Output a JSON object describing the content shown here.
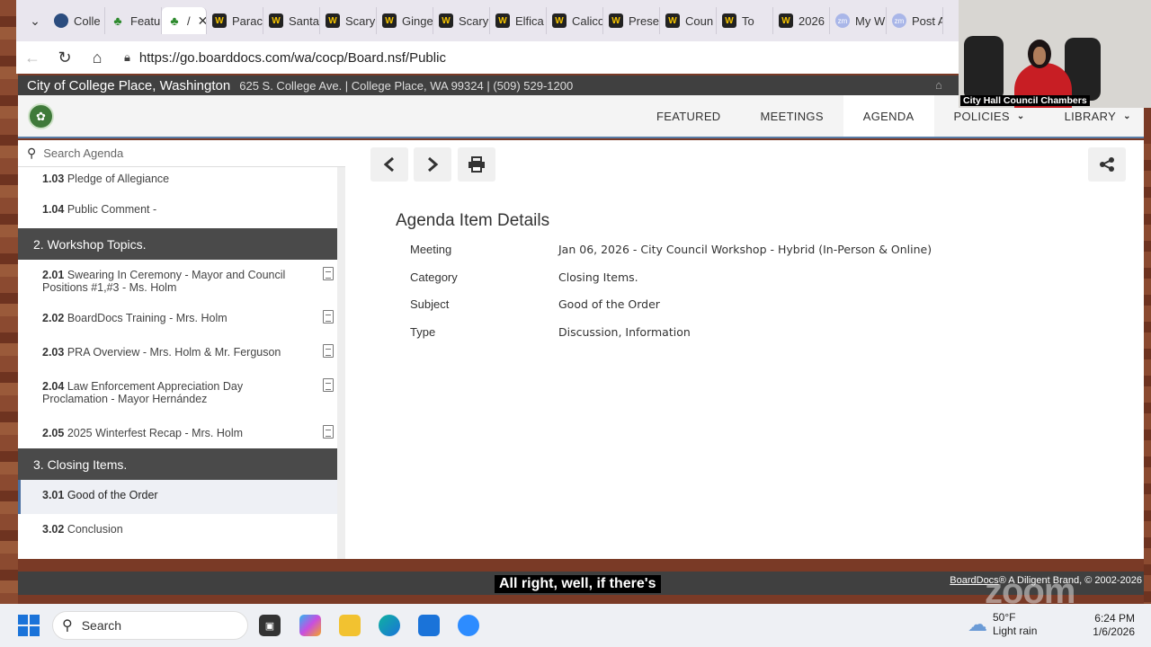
{
  "browser": {
    "tabs": [
      {
        "icon": "globe",
        "label": "Colle"
      },
      {
        "icon": "tree",
        "label": "Featu"
      },
      {
        "icon": "tree",
        "label": "/",
        "active": true
      },
      {
        "icon": "boarddocs",
        "label": "Parac"
      },
      {
        "icon": "boarddocs",
        "label": "Santa"
      },
      {
        "icon": "boarddocs",
        "label": "Scary"
      },
      {
        "icon": "boarddocs",
        "label": "Ginge"
      },
      {
        "icon": "boarddocs",
        "label": "Scary"
      },
      {
        "icon": "boarddocs",
        "label": "Elfica"
      },
      {
        "icon": "boarddocs",
        "label": "Calico"
      },
      {
        "icon": "boarddocs",
        "label": "Prese"
      },
      {
        "icon": "boarddocs",
        "label": "Coun"
      },
      {
        "icon": "boarddocs",
        "label": "To"
      },
      {
        "icon": "boarddocs",
        "label": "2026"
      },
      {
        "icon": "zm",
        "label": "My W"
      },
      {
        "icon": "zm",
        "label": "Post A"
      }
    ],
    "url": "https://go.boarddocs.com/wa/cocp/Board.nsf/Public"
  },
  "site": {
    "title": "City of College Place, Washington",
    "address": "625 S. College Ave. | College Place, WA 99324 | (509) 529-1200",
    "menu": [
      {
        "label": "FEATURED",
        "dropdown": false
      },
      {
        "label": "MEETINGS",
        "dropdown": false
      },
      {
        "label": "AGENDA",
        "dropdown": false,
        "active": true
      },
      {
        "label": "POLICIES",
        "dropdown": true
      },
      {
        "label": "LIBRARY",
        "dropdown": true
      }
    ]
  },
  "sidebar": {
    "search_placeholder": "Search Agenda",
    "items": [
      {
        "kind": "item",
        "num": "1.03",
        "text": "Pledge of Allegiance",
        "doc": false
      },
      {
        "kind": "item",
        "num": "1.04",
        "text": "Public Comment -",
        "doc": false
      },
      {
        "kind": "section",
        "text": "2. Workshop Topics."
      },
      {
        "kind": "item",
        "num": "2.01",
        "text": "Swearing In Ceremony - Mayor and Council Positions #1,#3 - Ms. Holm",
        "doc": true
      },
      {
        "kind": "item",
        "num": "2.02",
        "text": "BoardDocs Training - Mrs. Holm",
        "doc": true
      },
      {
        "kind": "item",
        "num": "2.03",
        "text": "PRA Overview - Mrs. Holm & Mr. Ferguson",
        "doc": true
      },
      {
        "kind": "item",
        "num": "2.04",
        "text": "Law Enforcement Appreciation Day Proclamation - Mayor Hernández",
        "doc": true
      },
      {
        "kind": "item",
        "num": "2.05",
        "text": "2025 Winterfest Recap - Mrs. Holm",
        "doc": true
      },
      {
        "kind": "section",
        "text": "3. Closing Items."
      },
      {
        "kind": "item",
        "num": "3.01",
        "text": "Good of the Order",
        "doc": false,
        "selected": true
      },
      {
        "kind": "item",
        "num": "3.02",
        "text": "Conclusion",
        "doc": false
      }
    ]
  },
  "details": {
    "title": "Agenda Item Details",
    "rows": [
      {
        "label": "Meeting",
        "value": "Jan 06, 2026 - City Council Workshop - Hybrid (In-Person & Online)"
      },
      {
        "label": "Category",
        "value": "Closing Items."
      },
      {
        "label": "Subject",
        "value": "Good of the Order"
      },
      {
        "label": "Type",
        "value": "Discussion, Information"
      }
    ]
  },
  "footer": {
    "brand_link": "BoardDocs",
    "brand_rest": "® A Diligent Brand, © 2002-2026"
  },
  "video": {
    "label": "City Hall Council Chambers",
    "caption": "All right, well, if there's",
    "watermark": "zoom"
  },
  "taskbar": {
    "search_label": "Search",
    "weather_temp": "50°F",
    "weather_desc": "Light rain",
    "time": "6:24 PM",
    "date": "1/6/2026"
  }
}
